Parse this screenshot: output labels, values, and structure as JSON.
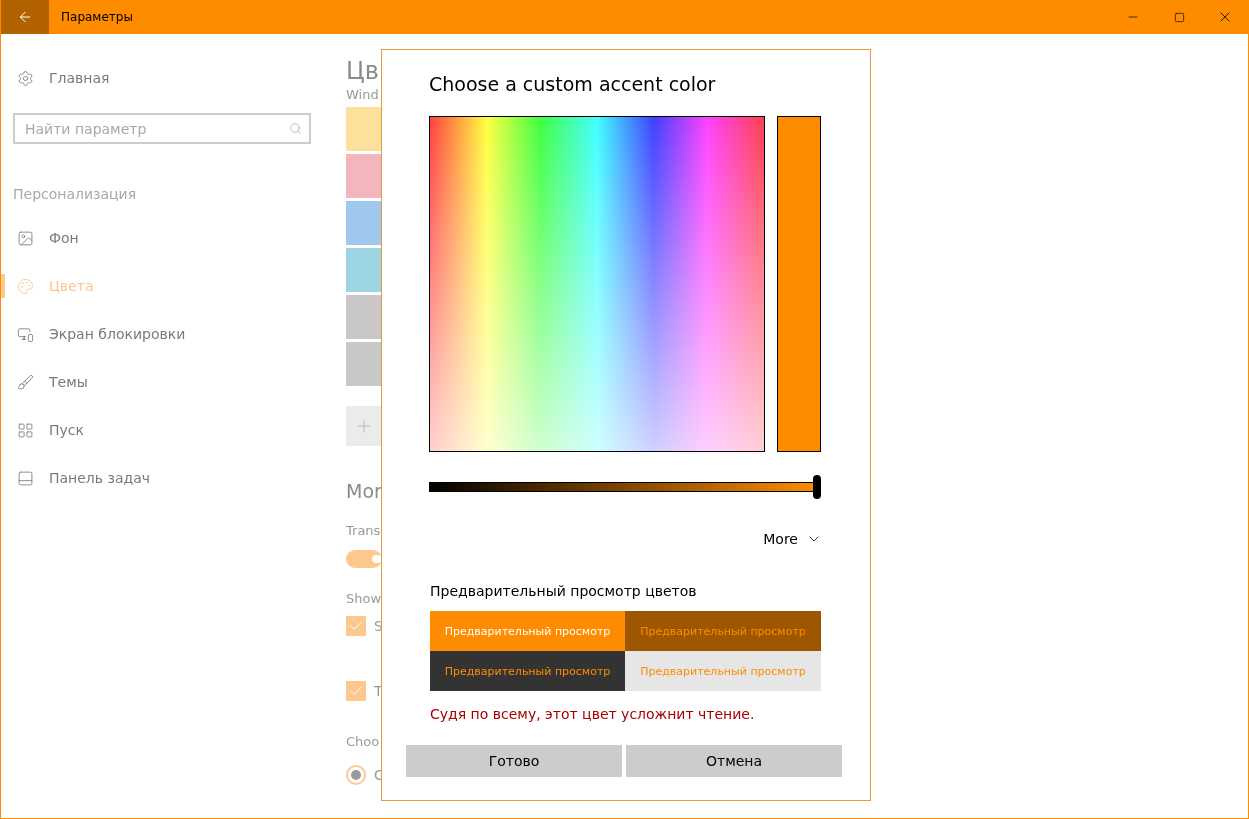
{
  "window": {
    "title": "Параметры"
  },
  "sidebar": {
    "home": "Главная",
    "search": {
      "placeholder": "Найти параметр"
    },
    "section": "Персонализация",
    "items": [
      {
        "label": "Фон",
        "selected": false
      },
      {
        "label": "Цвета",
        "selected": true
      },
      {
        "label": "Экран блокировки",
        "selected": false
      },
      {
        "label": "Темы",
        "selected": false
      },
      {
        "label": "Пуск",
        "selected": false
      },
      {
        "label": "Панель задач",
        "selected": false
      }
    ]
  },
  "content": {
    "heading": "Цв",
    "subtitle": "Wind",
    "swatches": [
      {
        "color": "#fde09a"
      },
      {
        "color": "#f4b6bd"
      },
      {
        "color": "#9ec8ee"
      },
      {
        "color": "#9dd6e2"
      },
      {
        "color": "#cac8c7"
      },
      {
        "color": "#c8c8c8"
      }
    ],
    "more_heading": "Mor",
    "transparency_label": "Trans",
    "transparency_toggle": {
      "on": true
    },
    "show_label": "Show",
    "checkboxes": [
      {
        "label": "S",
        "checked": true
      },
      {
        "label": "T",
        "checked": true
      }
    ],
    "choose_label": "Choo",
    "radios": [
      {
        "label": "C",
        "selected": true
      }
    ]
  },
  "dialog": {
    "title": "Choose a custom accent color",
    "slider": {
      "level": 1
    },
    "more": "More",
    "preview_title": "Предварительный просмотр цветов",
    "previews": [
      {
        "kind": "accent",
        "label": "Предварительный просмотр"
      },
      {
        "kind": "deep",
        "label": "Предварительный просмотр"
      },
      {
        "kind": "dark",
        "label": "Предварительный просмотр"
      },
      {
        "kind": "light",
        "label": "Предварительный просмотр"
      }
    ],
    "warning": "Судя по всему, этот цвет усложнит чтение.",
    "buttons": [
      "Готово",
      "Отмена"
    ]
  }
}
